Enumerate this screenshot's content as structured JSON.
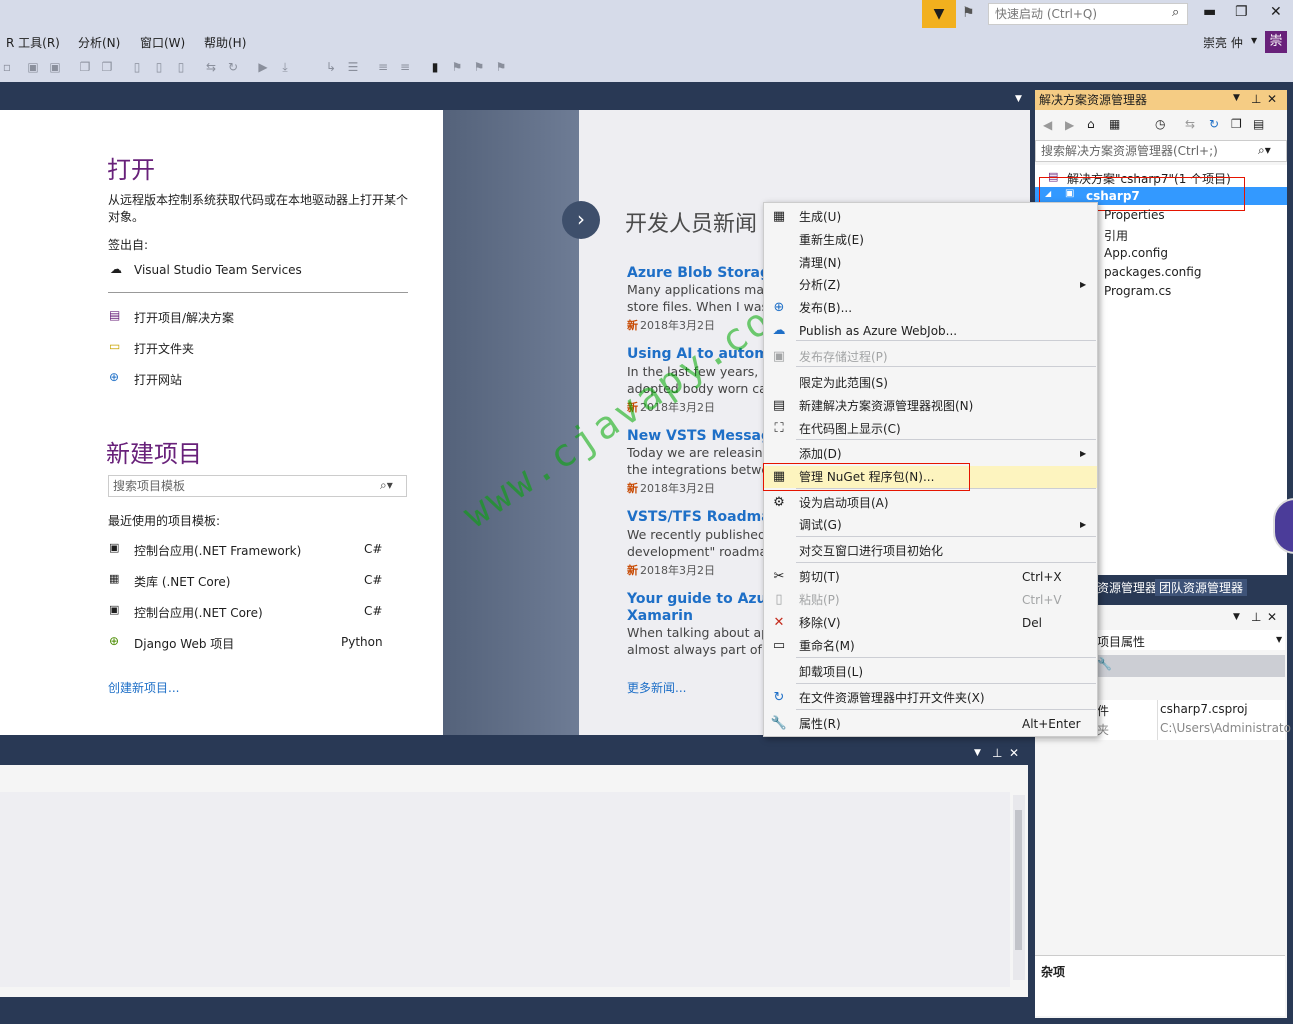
{
  "title_bar": {
    "quick_launch_placeholder": "快速启动 (Ctrl+Q)",
    "minimize": "▬",
    "restore": "❐",
    "close": "✕"
  },
  "menu": [
    "R 工具(R)",
    "分析(N)",
    "窗口(W)",
    "帮助(H)"
  ],
  "user": {
    "name": "崇亮 仲",
    "avatar": "崇"
  },
  "start_page": {
    "open_heading": "打开",
    "open_desc": "从远程版本控制系统获取代码或在本地驱动器上打开某个对象。",
    "checkout_label": "签出自:",
    "vsts": "Visual Studio Team Services",
    "open_project": "打开项目/解决方案",
    "open_folder": "打开文件夹",
    "open_website": "打开网站",
    "new_heading": "新建项目",
    "search_placeholder": "搜索项目模板",
    "recent_label": "最近使用的项目模板:",
    "templates": [
      {
        "name": "控制台应用(.NET Framework)",
        "lang": "C#"
      },
      {
        "name": "类库 (.NET Core)",
        "lang": "C#"
      },
      {
        "name": "控制台应用(.NET Core)",
        "lang": "C#"
      },
      {
        "name": "Django Web 项目",
        "lang": "Python"
      }
    ],
    "create_new": "创建新项目..."
  },
  "news": {
    "heading": "开发人员新闻",
    "items": [
      {
        "title": "Azure Blob Storage a",
        "body1": "Many applications mak",
        "body2": "store files. When I was",
        "date": "2018年3月2日"
      },
      {
        "title": "Using AI to automat",
        "body1": "In the last few years, m",
        "body2": "adopted body worn ca",
        "date": "2018年3月2日"
      },
      {
        "title": "New VSTS Messagin",
        "body1": "Today we are releasing",
        "body2": "the integrations betwee",
        "date": "2018年3月2日"
      },
      {
        "title": "VSTS/TFS Roadmap",
        "body1": "We recently published a",
        "body2": "development\" roadmap",
        "date": "2018年3月2日"
      },
      {
        "title": "Your guide to Azure",
        "title2": "Xamarin",
        "body1": "When talking about app",
        "body2": "almost always part of th",
        "date": ""
      }
    ],
    "new_badge": "新",
    "more": "更多新闻..."
  },
  "watermark": "www.cjavapy.com",
  "context_menu": {
    "items": [
      {
        "icon": "build-icon",
        "glyph": "▦",
        "label": "生成(U)"
      },
      {
        "icon": "",
        "glyph": "",
        "label": "重新生成(E)"
      },
      {
        "icon": "",
        "glyph": "",
        "label": "清理(N)"
      },
      {
        "icon": "",
        "glyph": "",
        "label": "分析(Z)",
        "submenu": true
      },
      {
        "icon": "publish-icon",
        "glyph": "⊕",
        "label": "发布(B)..."
      },
      {
        "icon": "azure-cloud-icon",
        "glyph": "☁",
        "label": "Publish as Azure WebJob..."
      },
      {
        "icon": "stored-proc-icon",
        "glyph": "▣",
        "label": "发布存储过程(P)",
        "disabled": true
      },
      {
        "icon": "",
        "glyph": "",
        "label": "限定为此范围(S)"
      },
      {
        "icon": "new-view-icon",
        "glyph": "▤",
        "label": "新建解决方案资源管理器视图(N)"
      },
      {
        "icon": "code-map-icon",
        "glyph": "⛶",
        "label": "在代码图上显示(C)"
      },
      {
        "icon": "",
        "glyph": "",
        "label": "添加(D)",
        "submenu": true
      },
      {
        "icon": "nuget-icon",
        "glyph": "▦",
        "label": "管理 NuGet 程序包(N)..."
      },
      {
        "icon": "gear-icon",
        "glyph": "⚙",
        "label": "设为启动项目(A)"
      },
      {
        "icon": "",
        "glyph": "",
        "label": "调试(G)",
        "submenu": true
      },
      {
        "icon": "",
        "glyph": "",
        "label": "对交互窗口进行项目初始化"
      },
      {
        "icon": "cut-icon",
        "glyph": "✂",
        "label": "剪切(T)",
        "shortcut": "Ctrl+X"
      },
      {
        "icon": "paste-icon",
        "glyph": "▯",
        "label": "粘贴(P)",
        "shortcut": "Ctrl+V",
        "disabled": true
      },
      {
        "icon": "delete-icon",
        "glyph": "✕",
        "label": "移除(V)",
        "shortcut": "Del"
      },
      {
        "icon": "rename-icon",
        "glyph": "▭",
        "label": "重命名(M)"
      },
      {
        "icon": "",
        "glyph": "",
        "label": "卸载项目(L)"
      },
      {
        "icon": "open-folder-icon",
        "glyph": "↻",
        "label": "在文件资源管理器中打开文件夹(X)"
      },
      {
        "icon": "wrench-icon",
        "glyph": "🔧",
        "label": "属性(R)",
        "shortcut": "Alt+Enter"
      }
    ]
  },
  "solution_explorer": {
    "title": "解决方案资源管理器",
    "search_placeholder": "搜索解决方案资源管理器(Ctrl+;)",
    "solution": "解决方案\"csharp7\"(1 个项目)",
    "project": "csharp7",
    "children": [
      "Properties",
      "引用",
      "App.config",
      "packages.config",
      "Program.cs"
    ],
    "tab_se": "资源管理器",
    "tab_team": "团队资源管理器"
  },
  "properties": {
    "title": "项目属性",
    "rows": [
      {
        "key": "件",
        "value": "csharp7.csproj"
      },
      {
        "key": "夹",
        "value": "C:\\Users\\Administrato"
      }
    ],
    "footer": "杂项"
  },
  "colors": {
    "accent": "#68217a",
    "link": "#1e6fc7",
    "selection": "#3399ff",
    "highlight": "#fdf4bf",
    "red_box": "#e51400"
  }
}
